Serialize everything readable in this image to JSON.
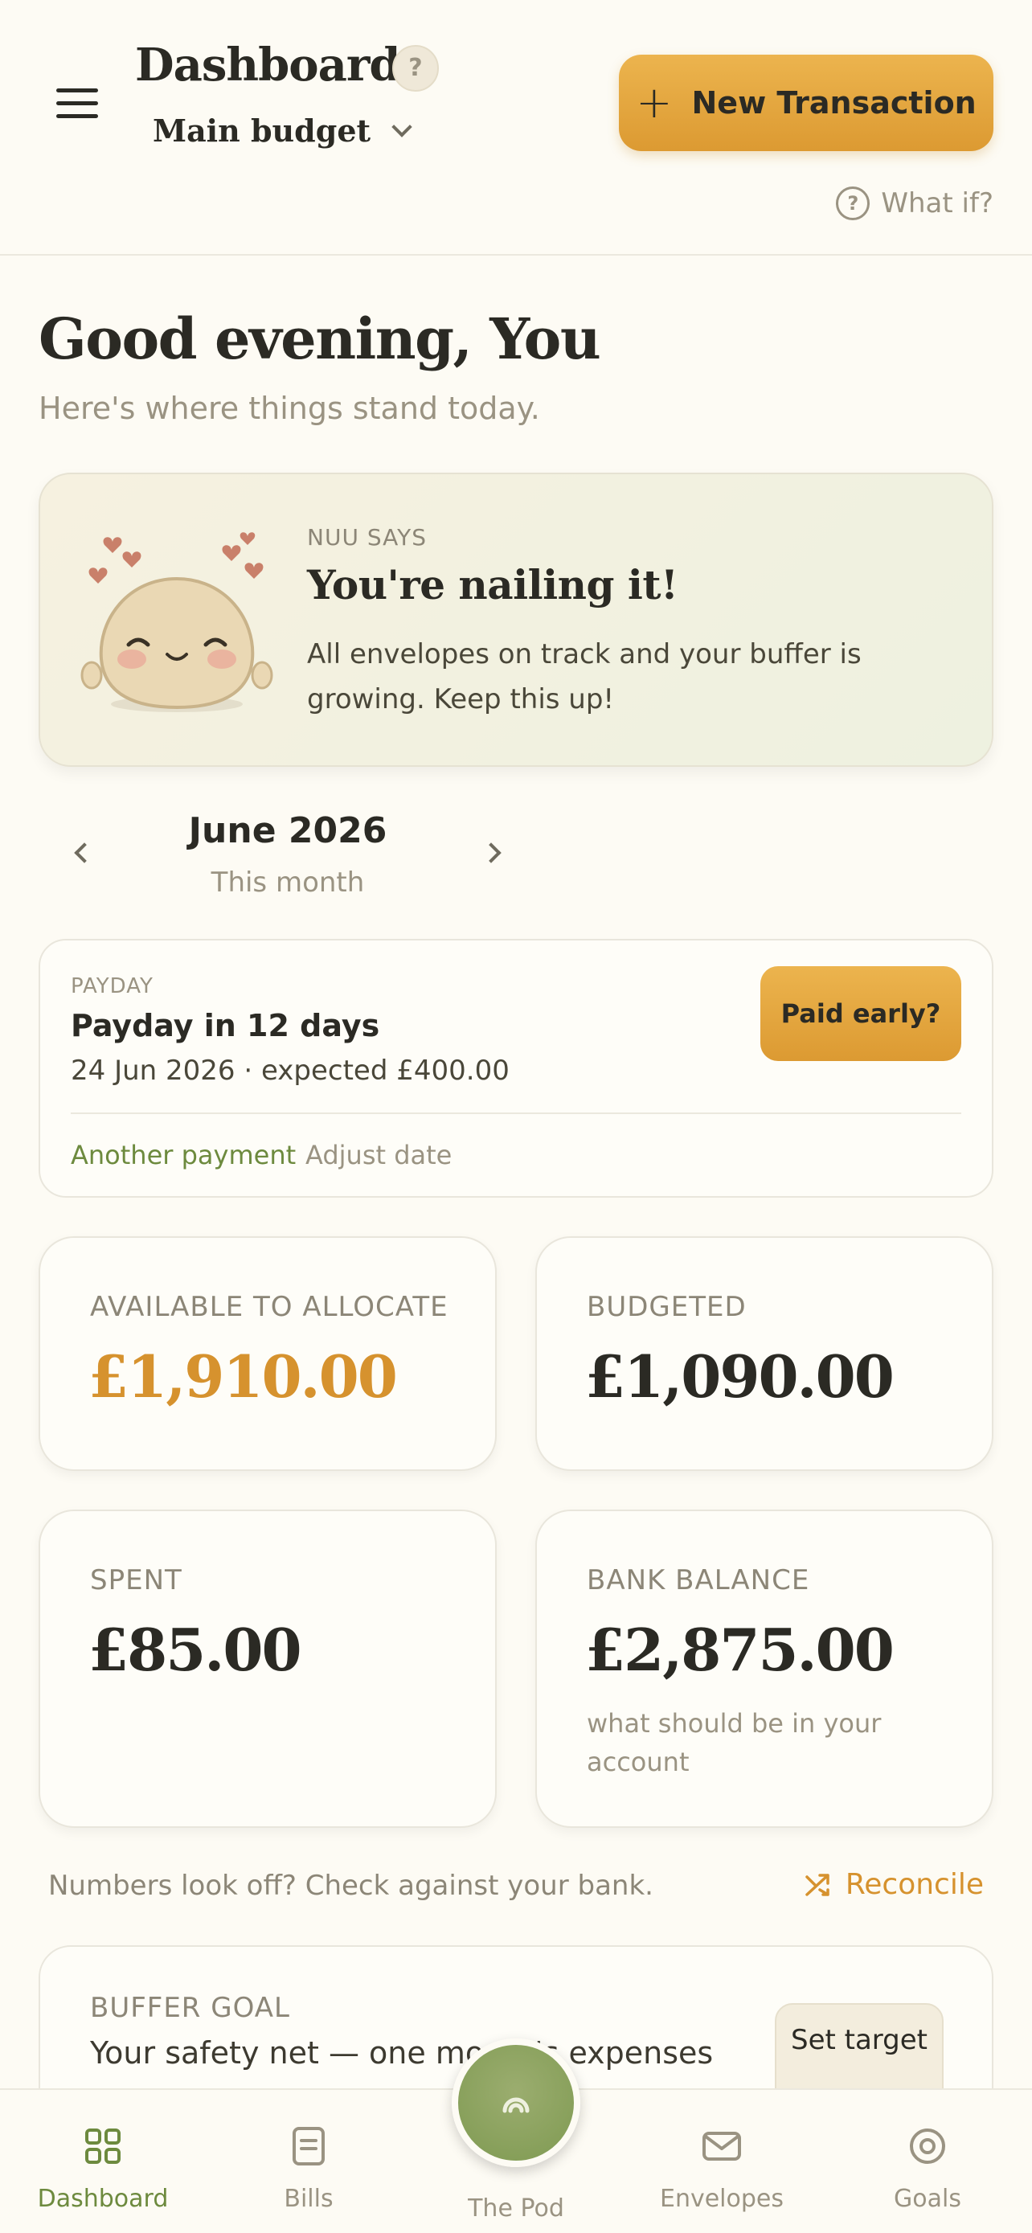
{
  "header": {
    "title": "Dashboard",
    "help_badge": "?",
    "budget_selector": "Main budget",
    "new_transaction_label": "New Transaction",
    "what_if_label": "What if?"
  },
  "greeting": {
    "title": "Good evening, You",
    "subtitle": "Here's where things stand today."
  },
  "nuu_card": {
    "kicker": "NUU SAYS",
    "headline": "You're nailing it!",
    "body": "All envelopes on track and your buffer is growing. Keep this up!"
  },
  "month": {
    "title": "June 2026",
    "subtitle": "This month"
  },
  "payday": {
    "kicker": "PAYDAY",
    "title": "Payday in 12 days",
    "detail": "24 Jun 2026 · expected £400.00",
    "paid_early_label": "Paid early?",
    "another_payment_label": "Another payment",
    "adjust_date_label": "Adjust date"
  },
  "stats": {
    "available": {
      "label": "AVAILABLE TO ALLOCATE",
      "value": "£1,910.00"
    },
    "budgeted": {
      "label": "BUDGETED",
      "value": "£1,090.00"
    },
    "spent": {
      "label": "SPENT",
      "value": "£85.00"
    },
    "bank_balance": {
      "label": "BANK BALANCE",
      "value": "£2,875.00",
      "note": "what should be in your account"
    }
  },
  "reconcile": {
    "text": "Numbers look off? Check against your bank.",
    "link_label": "Reconcile"
  },
  "buffer": {
    "label": "BUFFER GOAL",
    "description": "Your safety net — one month's expenses",
    "set_target_label": "Set target"
  },
  "bottom_nav": {
    "items": [
      {
        "label": "Dashboard",
        "icon": "grid-icon",
        "active": true
      },
      {
        "label": "Bills",
        "icon": "bill-icon",
        "active": false
      },
      {
        "label": "The Pod",
        "icon": "pod-icon",
        "active": false
      },
      {
        "label": "Envelopes",
        "icon": "envelope-icon",
        "active": false
      },
      {
        "label": "Goals",
        "icon": "target-icon",
        "active": false
      }
    ]
  },
  "colors": {
    "background": "#fdfbf4",
    "accent_amber": "#d6922e",
    "accent_green": "#6d8a3e",
    "text_dark": "#2b2a24",
    "text_muted": "#9a9382"
  }
}
